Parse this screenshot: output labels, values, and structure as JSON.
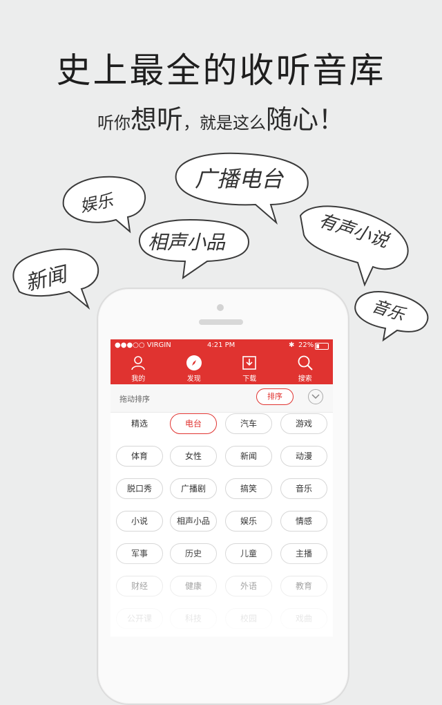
{
  "promo": {
    "headline": "史上最全的收听音库",
    "sub_part1": "听你",
    "sub_bold1": "想听",
    "sub_part2": "，就是这么",
    "sub_bold2": "随心",
    "sub_end": "！"
  },
  "bubbles": [
    "新闻",
    "娱乐",
    "相声小品",
    "广播电台",
    "有声小说",
    "音乐"
  ],
  "status_bar": {
    "carrier": "●●●○○ VIRGIN",
    "time": "4:21 PM",
    "battery": "22%"
  },
  "nav": {
    "items": [
      {
        "label": "我的",
        "icon": "person-icon"
      },
      {
        "label": "发现",
        "icon": "compass-icon"
      },
      {
        "label": "下载",
        "icon": "download-icon"
      },
      {
        "label": "搜索",
        "icon": "search-icon"
      }
    ]
  },
  "sort_row": {
    "label": "拖动排序",
    "button": "排序"
  },
  "categories": [
    [
      "精选",
      "电台",
      "汽车",
      "游戏"
    ],
    [
      "体育",
      "女性",
      "新闻",
      "动漫"
    ],
    [
      "脱口秀",
      "广播剧",
      "搞笑",
      "音乐"
    ],
    [
      "小说",
      "相声小品",
      "娱乐",
      "情感"
    ],
    [
      "军事",
      "历史",
      "儿童",
      "主播"
    ],
    [
      "财经",
      "健康",
      "外语",
      "教育"
    ],
    [
      "公开课",
      "科技",
      "校园",
      "戏曲"
    ]
  ],
  "selected_category": "电台",
  "colors": {
    "accent": "#e03330",
    "background": "#eceded"
  }
}
